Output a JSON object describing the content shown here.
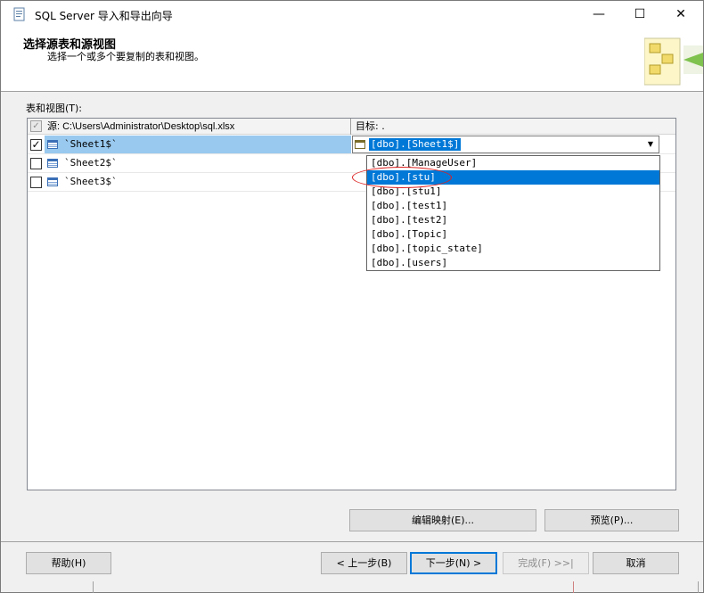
{
  "window": {
    "title": "SQL Server 导入和导出向导",
    "controls": {
      "minimize": "—",
      "maximize": "☐",
      "close": "✕"
    }
  },
  "header": {
    "title": "选择源表和源视图",
    "subtitle": "选择一个或多个要复制的表和视图。"
  },
  "tables_label": "表和视图(T):",
  "grid": {
    "source_header": "源: C:\\Users\\Administrator\\Desktop\\sql.xlsx",
    "dest_header": "目标: .",
    "rows": [
      {
        "source": "`Sheet1$`",
        "checked": true,
        "selected": true,
        "destination": "[dbo].[Sheet1$]"
      },
      {
        "source": "`Sheet2$`",
        "checked": false,
        "selected": false,
        "destination": ""
      },
      {
        "source": "`Sheet3$`",
        "checked": false,
        "selected": false,
        "destination": ""
      }
    ]
  },
  "dropdown": {
    "items": [
      "[dbo].[ManageUser]",
      "[dbo].[stu]",
      "[dbo].[stu1]",
      "[dbo].[test1]",
      "[dbo].[test2]",
      "[dbo].[Topic]",
      "[dbo].[topic_state]",
      "[dbo].[users]"
    ],
    "highlighted": "[dbo].[stu]"
  },
  "buttons": {
    "edit_mappings": "编辑映射(E)...",
    "preview": "预览(P)...",
    "help": "帮助(H)",
    "back": "< 上一步(B)",
    "next": "下一步(N) >",
    "finish": "完成(F) >>|",
    "cancel": "取消"
  },
  "colors": {
    "selection": "#0078d7",
    "row_selected": "#99c9ef",
    "annotation": "#dd2222"
  }
}
